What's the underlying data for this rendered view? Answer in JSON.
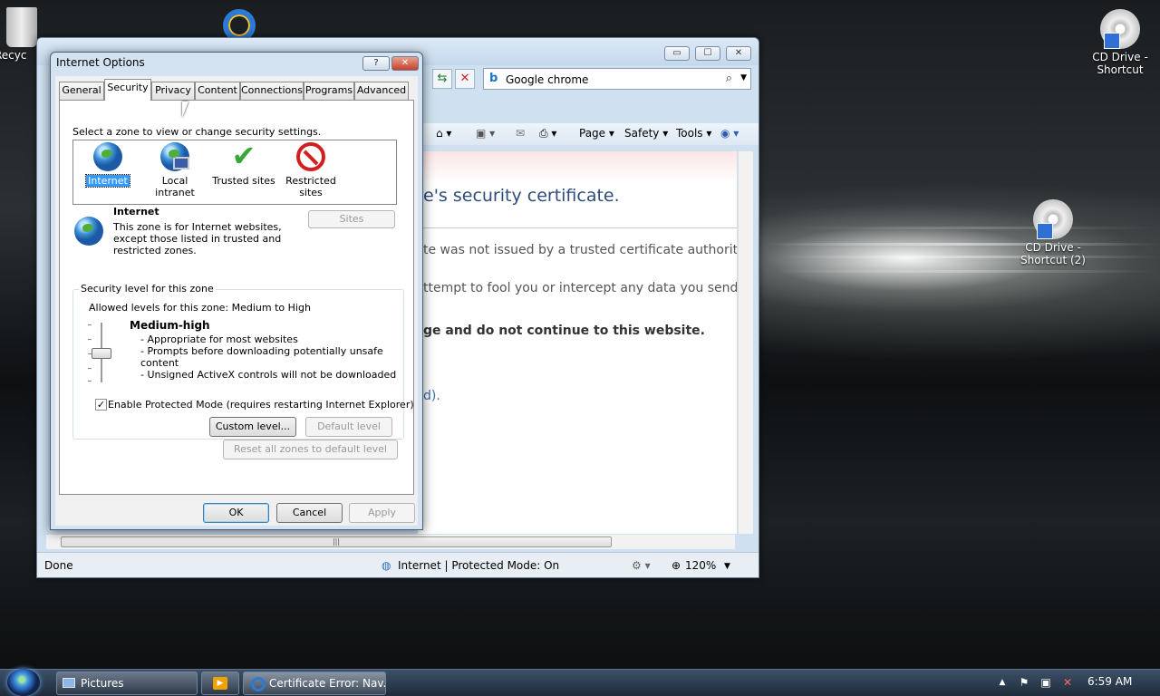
{
  "desktop": {
    "icons": [
      {
        "label": "Recyc"
      },
      {
        "label": "CD Drive -\nShortcut"
      },
      {
        "label": "CD Drive -\nShortcut (2)"
      }
    ]
  },
  "ie": {
    "search_query": "Google chrome",
    "commands": [
      "Page",
      "Safety",
      "Tools"
    ],
    "content": {
      "heading": "e's security certificate.",
      "line1": "te was not issued by a trusted certificate authority.",
      "line2": "ttempt to fool you or intercept any data you send t",
      "line3": "ge and do not continue to this website.",
      "line4": "d)."
    },
    "status": {
      "left": "Done",
      "zone": "Internet | Protected Mode: On",
      "zoom": "120%"
    }
  },
  "dialog": {
    "title": "Internet Options",
    "help_label": "?",
    "close_label": "✕",
    "tabs": [
      "General",
      "Security",
      "Privacy",
      "Content",
      "Connections",
      "Programs",
      "Advanced"
    ],
    "active_tab": "Security",
    "zone_prompt": "Select a zone to view or change security settings.",
    "zones": [
      {
        "label": "Internet",
        "icon": "globe-icon"
      },
      {
        "label": "Local intranet",
        "icon": "intranet-icon"
      },
      {
        "label": "Trusted sites",
        "icon": "checkmark-icon"
      },
      {
        "label": "Restricted\nsites",
        "icon": "no-entry-icon"
      }
    ],
    "selected_zone": "Internet",
    "zone_name": "Internet",
    "zone_description": "This zone is for Internet websites,\nexcept those listed in trusted and\nrestricted zones.",
    "sites_label": "Sites",
    "security_level_legend": "Security level for this zone",
    "allowed_levels": "Allowed levels for this zone: Medium to High",
    "level_name": "Medium-high",
    "level_points": [
      "- Appropriate for most websites",
      "- Prompts before downloading potentially unsafe",
      "content",
      "- Unsigned ActiveX controls will not be downloaded"
    ],
    "protected_mode_label": "Enable Protected Mode (requires restarting Internet Explorer)",
    "protected_mode_checked": true,
    "custom_level_label": "Custom level...",
    "default_level_label": "Default level",
    "reset_all_label": "Reset all zones to default level",
    "ok_label": "OK",
    "cancel_label": "Cancel",
    "apply_label": "Apply"
  },
  "taskbar": {
    "items": [
      "Pictures",
      "",
      "Certificate Error: Nav..."
    ],
    "clock": "6:59 AM"
  }
}
